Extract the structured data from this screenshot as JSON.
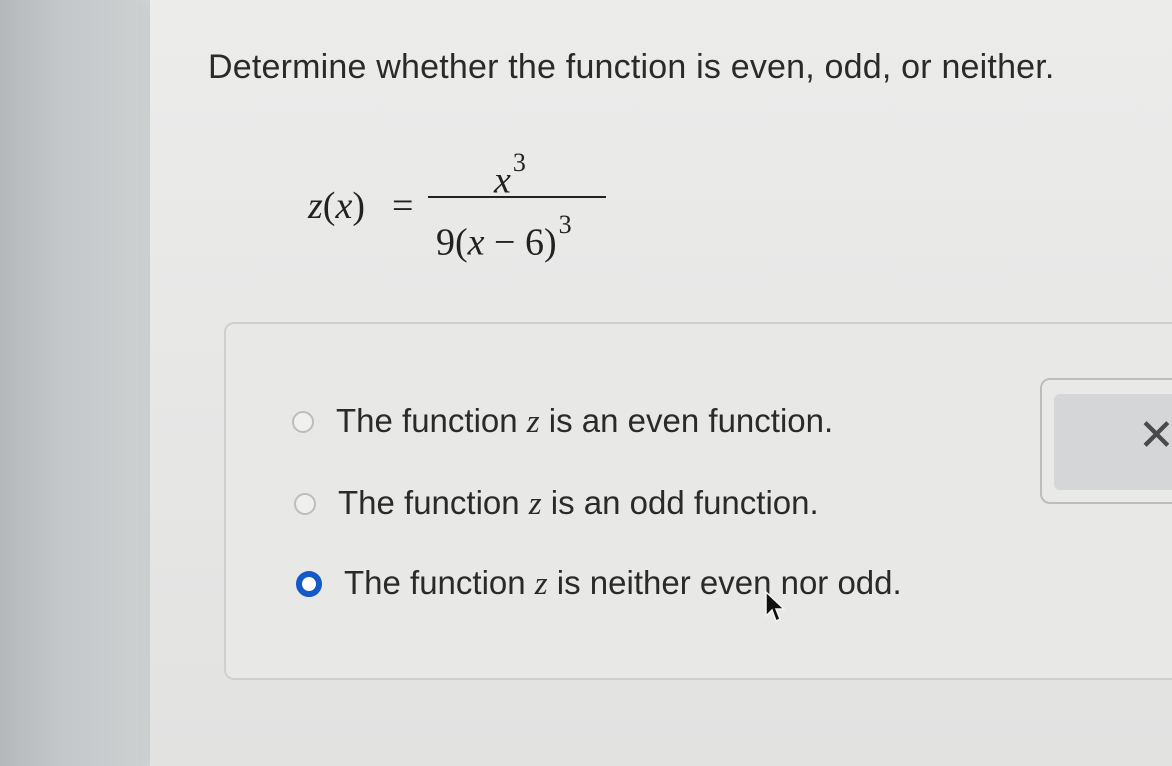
{
  "question": {
    "prompt": "Determine whether the function is even, odd, or neither."
  },
  "formula": {
    "lhs_fn": "z",
    "lhs_open": "(",
    "lhs_var": "x",
    "lhs_close": ")",
    "equals": "=",
    "num_base": "x",
    "num_exp": "3",
    "den_coef": "9",
    "den_open": "(",
    "den_var": "x",
    "den_rest": " − 6)",
    "den_exp": "3"
  },
  "options": [
    {
      "pre": "The function ",
      "var": "z",
      "post": " is an even function.",
      "selected": false
    },
    {
      "pre": "The function ",
      "var": "z",
      "post": " is an odd function.",
      "selected": false
    },
    {
      "pre": "The function ",
      "var": "z",
      "post": " is neither even nor odd.",
      "selected": true
    }
  ],
  "close_button": {
    "icon": "close-icon",
    "glyph": "✕"
  },
  "colors": {
    "radio_selected": "#1558c7",
    "text": "#2a2a2a"
  }
}
